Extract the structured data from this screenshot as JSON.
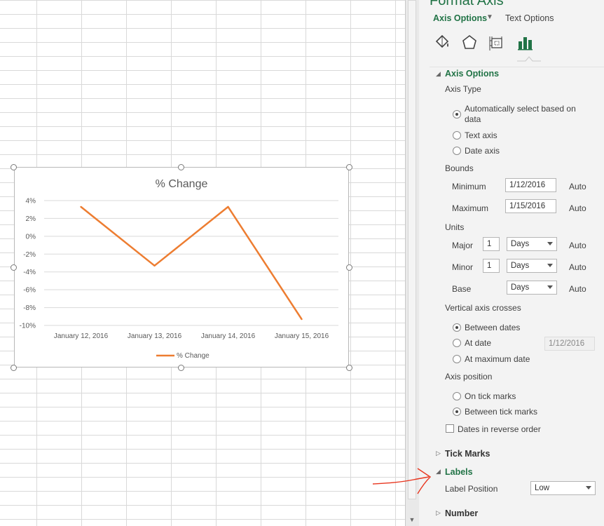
{
  "chart": {
    "title": "% Change",
    "legend_label": "% Change",
    "line_color": "#ED7D31"
  },
  "chart_data": {
    "type": "line",
    "title": "% Change",
    "categories": [
      "January 12, 2016",
      "January 13, 2016",
      "January 14, 2016",
      "January 15, 2016"
    ],
    "series": [
      {
        "name": "% Change",
        "values": [
          3.3,
          -3.3,
          3.3,
          -9.3
        ]
      }
    ],
    "y_ticks": [
      "4%",
      "2%",
      "0%",
      "-2%",
      "-4%",
      "-6%",
      "-8%",
      "-10%"
    ],
    "ylim": [
      -10,
      4
    ],
    "grid": true,
    "legend_position": "bottom"
  },
  "pane": {
    "title": "Format Axis",
    "tab_axis_options": "Axis Options",
    "tab_text_options": "Text Options",
    "icons": [
      "fill-line-icon",
      "effects-icon",
      "size-properties-icon",
      "axis-options-icon"
    ],
    "accent": "#217346",
    "axis_options_head": "Axis Options",
    "axis_type_label": "Axis Type",
    "axis_type_options": [
      "Automatically select based on data",
      "Text axis",
      "Date axis"
    ],
    "bounds_label": "Bounds",
    "minimum_label": "Minimum",
    "minimum_value": "1/12/2016",
    "maximum_label": "Maximum",
    "maximum_value": "1/15/2016",
    "auto": "Auto",
    "units_label": "Units",
    "major_label": "Major",
    "major_value": "1",
    "major_unit": "Days",
    "minor_label": "Minor",
    "minor_value": "1",
    "minor_unit": "Days",
    "base_label": "Base",
    "base_unit": "Days",
    "vac_label": "Vertical axis crosses",
    "vac_options": [
      "Between dates",
      "At date",
      "At maximum date"
    ],
    "at_date_value": "1/12/2016",
    "axis_position_label": "Axis position",
    "axis_position_options": [
      "On tick marks",
      "Between tick marks"
    ],
    "reverse_label": "Dates in reverse order",
    "tick_marks_head": "Tick Marks",
    "labels_head": "Labels",
    "label_position_label": "Label Position",
    "label_position_value": "Low",
    "number_head": "Number"
  }
}
